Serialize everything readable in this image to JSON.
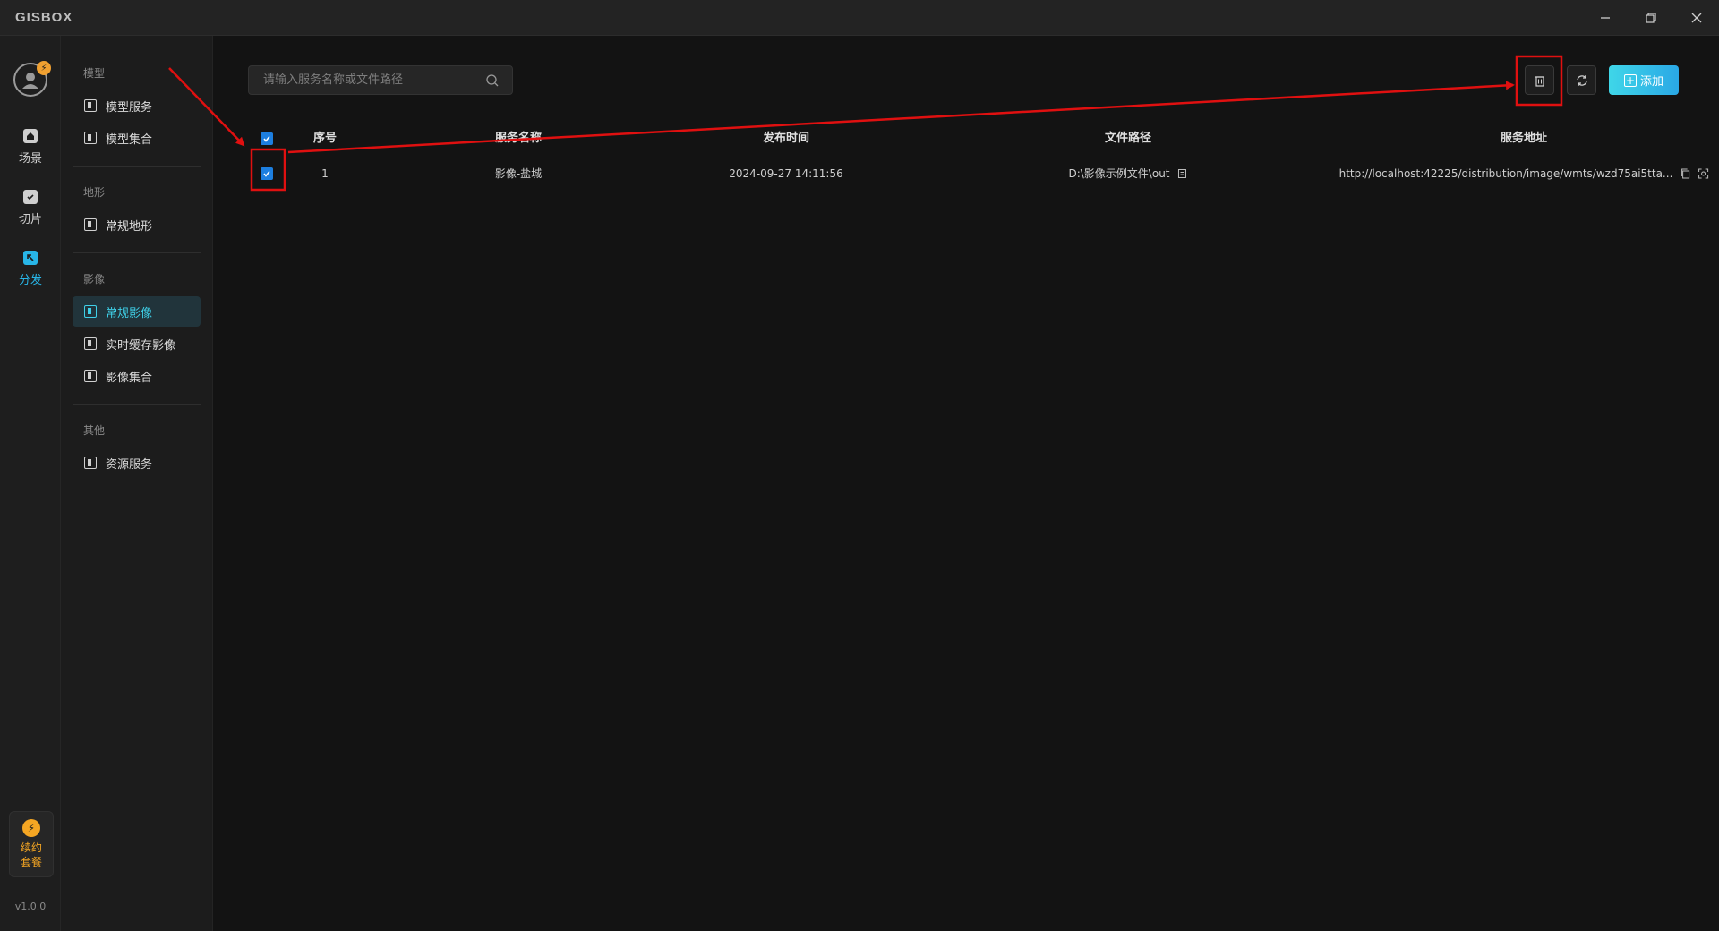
{
  "app": {
    "logo": "GISBOX",
    "version": "v1.0.0"
  },
  "window": {
    "minimize": "minimize",
    "restore": "restore",
    "close": "close"
  },
  "rail": {
    "items": [
      {
        "label": "场景",
        "icon": "home-icon"
      },
      {
        "label": "切片",
        "icon": "slice-icon"
      },
      {
        "label": "分发",
        "icon": "distribute-icon"
      }
    ],
    "renew": {
      "label": "续约套餐",
      "icon": "lightning-icon"
    }
  },
  "subnav": {
    "groups": [
      {
        "title": "模型",
        "items": [
          "模型服务",
          "模型集合"
        ]
      },
      {
        "title": "地形",
        "items": [
          "常规地形"
        ]
      },
      {
        "title": "影像",
        "items": [
          "常规影像",
          "实时缓存影像",
          "影像集合"
        ]
      },
      {
        "title": "其他",
        "items": [
          "资源服务"
        ]
      }
    ],
    "active_item": "常规影像"
  },
  "toolbar": {
    "search_placeholder": "请输入服务名称或文件路径",
    "search_value": "",
    "delete_icon": "trash-icon",
    "refresh_icon": "refresh-icon",
    "add_label": "添加"
  },
  "table": {
    "columns": [
      "序号",
      "服务名称",
      "发布时间",
      "文件路径",
      "服务地址"
    ],
    "rows": [
      {
        "checked": true,
        "index": "1",
        "name": "影像-盐城",
        "time": "2024-09-27 14:11:56",
        "path": "D:\\影像示例文件\\out",
        "url": "http://localhost:42225/distribution/image/wmts/wzd75ai5tta..."
      }
    ],
    "all_checked": true
  },
  "colors": {
    "accent": "#28b6e8",
    "checkbox": "#1d7fe0",
    "annotation": "#e01010",
    "renew": "#f5a623"
  }
}
